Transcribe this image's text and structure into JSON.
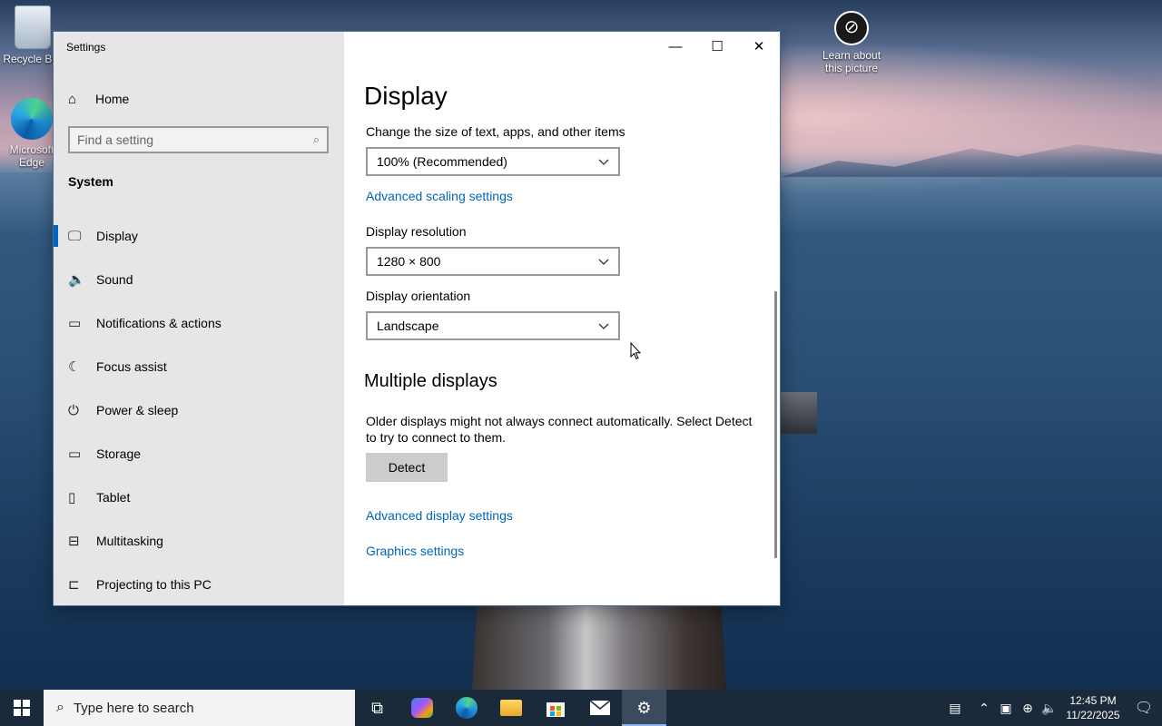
{
  "desktop": {
    "icons": [
      {
        "label": "Recycle Bin"
      },
      {
        "label": "Microsoft Edge"
      },
      {
        "label": "Learn about this picture"
      }
    ]
  },
  "window": {
    "title": "Settings",
    "controls": {
      "minimize": "—",
      "maximize": "☐",
      "close": "✕"
    }
  },
  "sidebar": {
    "home_label": "Home",
    "search_placeholder": "Find a setting",
    "section": "System",
    "items": [
      {
        "label": "Display",
        "icon": "monitor-icon",
        "active": true
      },
      {
        "label": "Sound",
        "icon": "speaker-icon"
      },
      {
        "label": "Notifications & actions",
        "icon": "message-icon"
      },
      {
        "label": "Focus assist",
        "icon": "moon-icon"
      },
      {
        "label": "Power & sleep",
        "icon": "power-icon"
      },
      {
        "label": "Storage",
        "icon": "storage-icon"
      },
      {
        "label": "Tablet",
        "icon": "tablet-icon"
      },
      {
        "label": "Multitasking",
        "icon": "multitasking-icon"
      },
      {
        "label": "Projecting to this PC",
        "icon": "projector-icon"
      }
    ]
  },
  "main": {
    "title": "Display",
    "scale_label": "Change the size of text, apps, and other items",
    "scale_value": "100% (Recommended)",
    "advanced_scaling_link": "Advanced scaling settings",
    "resolution_label": "Display resolution",
    "resolution_value": "1280 × 800",
    "orientation_label": "Display orientation",
    "orientation_value": "Landscape",
    "multiple_title": "Multiple displays",
    "multiple_text": "Older displays might not always connect automatically. Select Detect to try to connect to them.",
    "detect_button": "Detect",
    "advanced_display_link": "Advanced display settings",
    "graphics_link": "Graphics settings"
  },
  "taskbar": {
    "search_placeholder": "Type here to search",
    "apps": [
      "task-view-icon",
      "copilot-icon",
      "edge-icon",
      "file-explorer-icon",
      "store-icon",
      "mail-icon",
      "settings-icon"
    ],
    "time": "12:45 PM",
    "date": "11/22/2025"
  },
  "colors": {
    "accent": "#0067c0",
    "link": "#0067b8",
    "sidebar_bg": "#e6e6e6",
    "taskbar_bg": "#1b2a3b"
  }
}
